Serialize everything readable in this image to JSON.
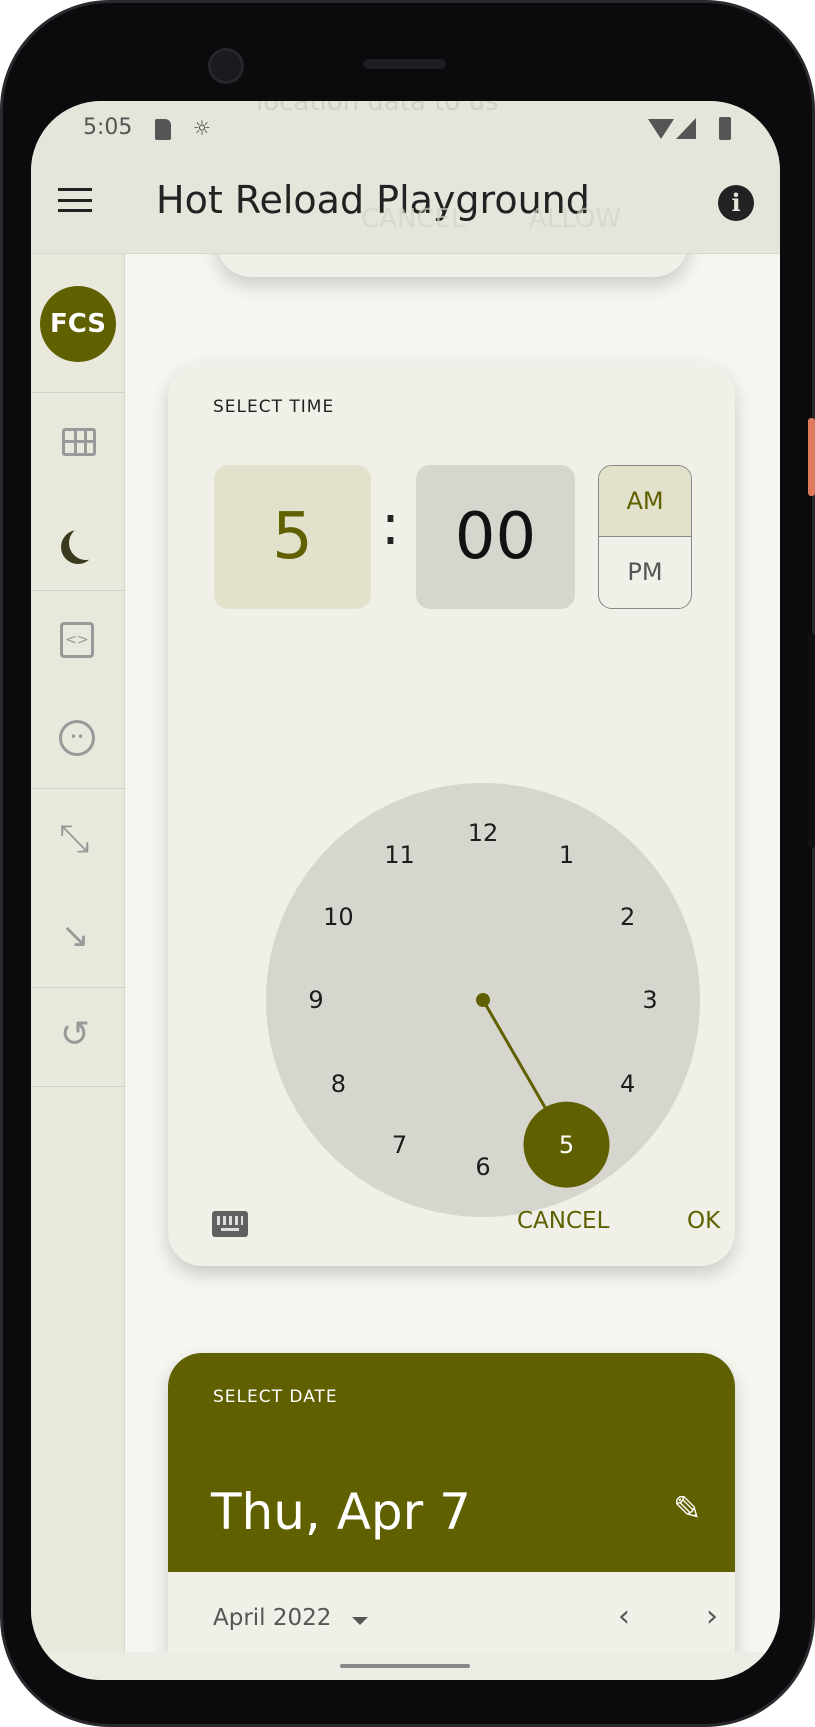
{
  "status_bar": {
    "time": "5:05"
  },
  "ghost_dialog": {
    "text": "location data to us",
    "cancel": "CANCEL",
    "allow": "ALLOW"
  },
  "app_bar": {
    "title": "Hot Reload Playground",
    "menu_icon": "menu-icon",
    "info_icon": "info-icon"
  },
  "rail": {
    "avatar": "FCS",
    "items": [
      "grid-icon",
      "dark-mode-icon",
      "code-icon",
      "palette-icon",
      "expand-icon",
      "collapse-icon",
      "refresh-icon"
    ]
  },
  "time_picker": {
    "label": "SELECT TIME",
    "hour": "5",
    "separator": ":",
    "minute": "00",
    "am": "AM",
    "pm": "PM",
    "selected_period": "AM",
    "dial_numbers": [
      "12",
      "1",
      "2",
      "3",
      "4",
      "5",
      "6",
      "7",
      "8",
      "9",
      "10",
      "11"
    ],
    "selected_hour": 5,
    "cancel": "CANCEL",
    "ok": "OK"
  },
  "date_picker": {
    "label": "SELECT DATE",
    "date": "Thu, Apr 7",
    "month": "April 2022"
  },
  "colors": {
    "primary": "#606000",
    "surface": "#f0f0e8",
    "background": "#f6f6f1"
  }
}
